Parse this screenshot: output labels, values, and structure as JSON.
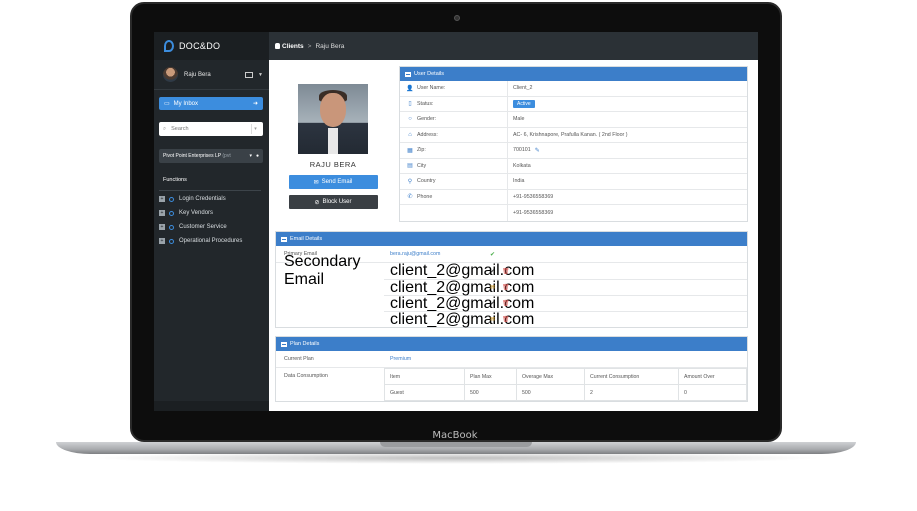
{
  "device": {
    "label": "MacBook"
  },
  "sidebar": {
    "brand": "DOC&DO",
    "user_name": "Raju Bera",
    "inbox_label": "My Inbox",
    "search_placeholder": "Search",
    "org_selected": "Pivot Point Enterprises LP",
    "org_suffix": "(pvt",
    "functions_title": "Functions",
    "menu": [
      {
        "label": "Login Credentials"
      },
      {
        "label": "Key Vendors"
      },
      {
        "label": "Customer Service"
      },
      {
        "label": "Operational Procedures"
      }
    ]
  },
  "header": {
    "crumb_root": "Clients",
    "crumb_sep": ">",
    "crumb_current": "Raju Bera"
  },
  "profile": {
    "name": "RAJU BERA",
    "send_email": "Send Email",
    "block_user": "Block User"
  },
  "user_details": {
    "title": "User Details",
    "rows": [
      {
        "icon": "user-icon",
        "key": "User Name:",
        "value": "Client_2"
      },
      {
        "icon": "mobile-icon",
        "key": "Status:",
        "value": "Active"
      },
      {
        "icon": "circle-icon",
        "key": "Gender:",
        "value": "Male"
      },
      {
        "icon": "home-icon",
        "key": "Address:",
        "value": "AC- 6, Krishnapore, Prafulla Kanan. ( 2nd Floor )"
      },
      {
        "icon": "zip-icon",
        "key": "Zip:",
        "value": "700101"
      },
      {
        "icon": "city-icon",
        "key": "City",
        "value": "Kolkata"
      },
      {
        "icon": "map-marker-icon",
        "key": "Country",
        "value": "India"
      },
      {
        "icon": "phone-icon",
        "key": "Phone",
        "value": "+91-9536558369"
      },
      {
        "icon": "",
        "key": "",
        "value": "+91-9536558369"
      }
    ]
  },
  "email_details": {
    "title": "Email Details",
    "primary_label": "Primary Email",
    "primary_value": "bera.raju@gmail.com",
    "secondary_label": "Secondary Email",
    "secondary": [
      {
        "address": "client_2@gmail.com",
        "status": "check"
      },
      {
        "address": "client_2@gmail.com",
        "status": "envelope"
      },
      {
        "address": "client_2@gmail.com",
        "status": "check"
      },
      {
        "address": "client_2@gmail.com",
        "status": "envelope"
      }
    ]
  },
  "plan_details": {
    "title": "Plan Details",
    "current_plan_label": "Current Plan",
    "current_plan_value": "Premium",
    "consumption_label": "Data Consumption",
    "columns": [
      "Item",
      "Plan Max",
      "Overage Max",
      "Current Consumption",
      "Amount Over"
    ],
    "rows": [
      [
        "Guest",
        "500",
        "500",
        "2",
        "0"
      ]
    ]
  },
  "colors": {
    "accent": "#3c8dde",
    "panel_header": "#3c7ec9",
    "sidebar": "#22272b"
  }
}
